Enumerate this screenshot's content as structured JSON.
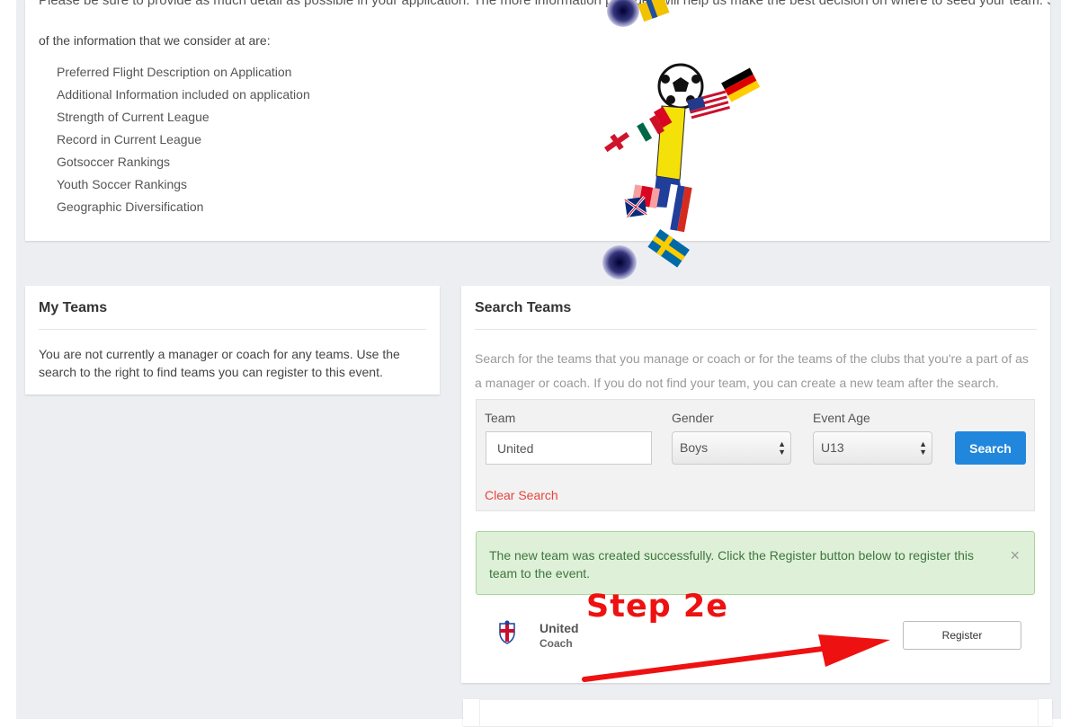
{
  "info": {
    "cut_text": "Please be sure to provide as much detail as possible in your application.  The more information provided will help us make the best decision on where to seed your team.  Some",
    "intro": "of the information that we consider at are:",
    "factors": [
      "Preferred Flight Description on Application",
      "Additional Information included on application",
      "Strength of Current League",
      "Record in Current League",
      "Gotsoccer Rankings",
      "Youth Soccer Rankings",
      "Geographic Diversification"
    ]
  },
  "my_teams": {
    "title": "My Teams",
    "message": "You are not currently a manager or coach for any teams. Use the search to the right to find teams you can register to this event."
  },
  "search_teams": {
    "title": "Search Teams",
    "description": "Search for the teams that you manage or coach or for the teams of the clubs that you're a part of as a manager or coach. If you do not find your team, you can create a new team after the search.",
    "team_label": "Team",
    "team_value": "United",
    "gender_label": "Gender",
    "gender_value": "Boys",
    "age_label": "Event Age",
    "age_value": "U13",
    "search_button": "Search",
    "clear_link": "Clear Search"
  },
  "alert": {
    "message": "The new team was created successfully. Click the Register button below to register this team to the event.",
    "close": "×"
  },
  "result": {
    "team_name": "United",
    "role": "Coach",
    "register_button": "Register"
  },
  "annotation": {
    "step": "Step 2e",
    "color": "#ee1111"
  },
  "colors": {
    "primary_button": "#2187dd",
    "clear_link": "#e8453c",
    "alert_bg": "#dff0d8",
    "alert_text": "#3c763d"
  }
}
